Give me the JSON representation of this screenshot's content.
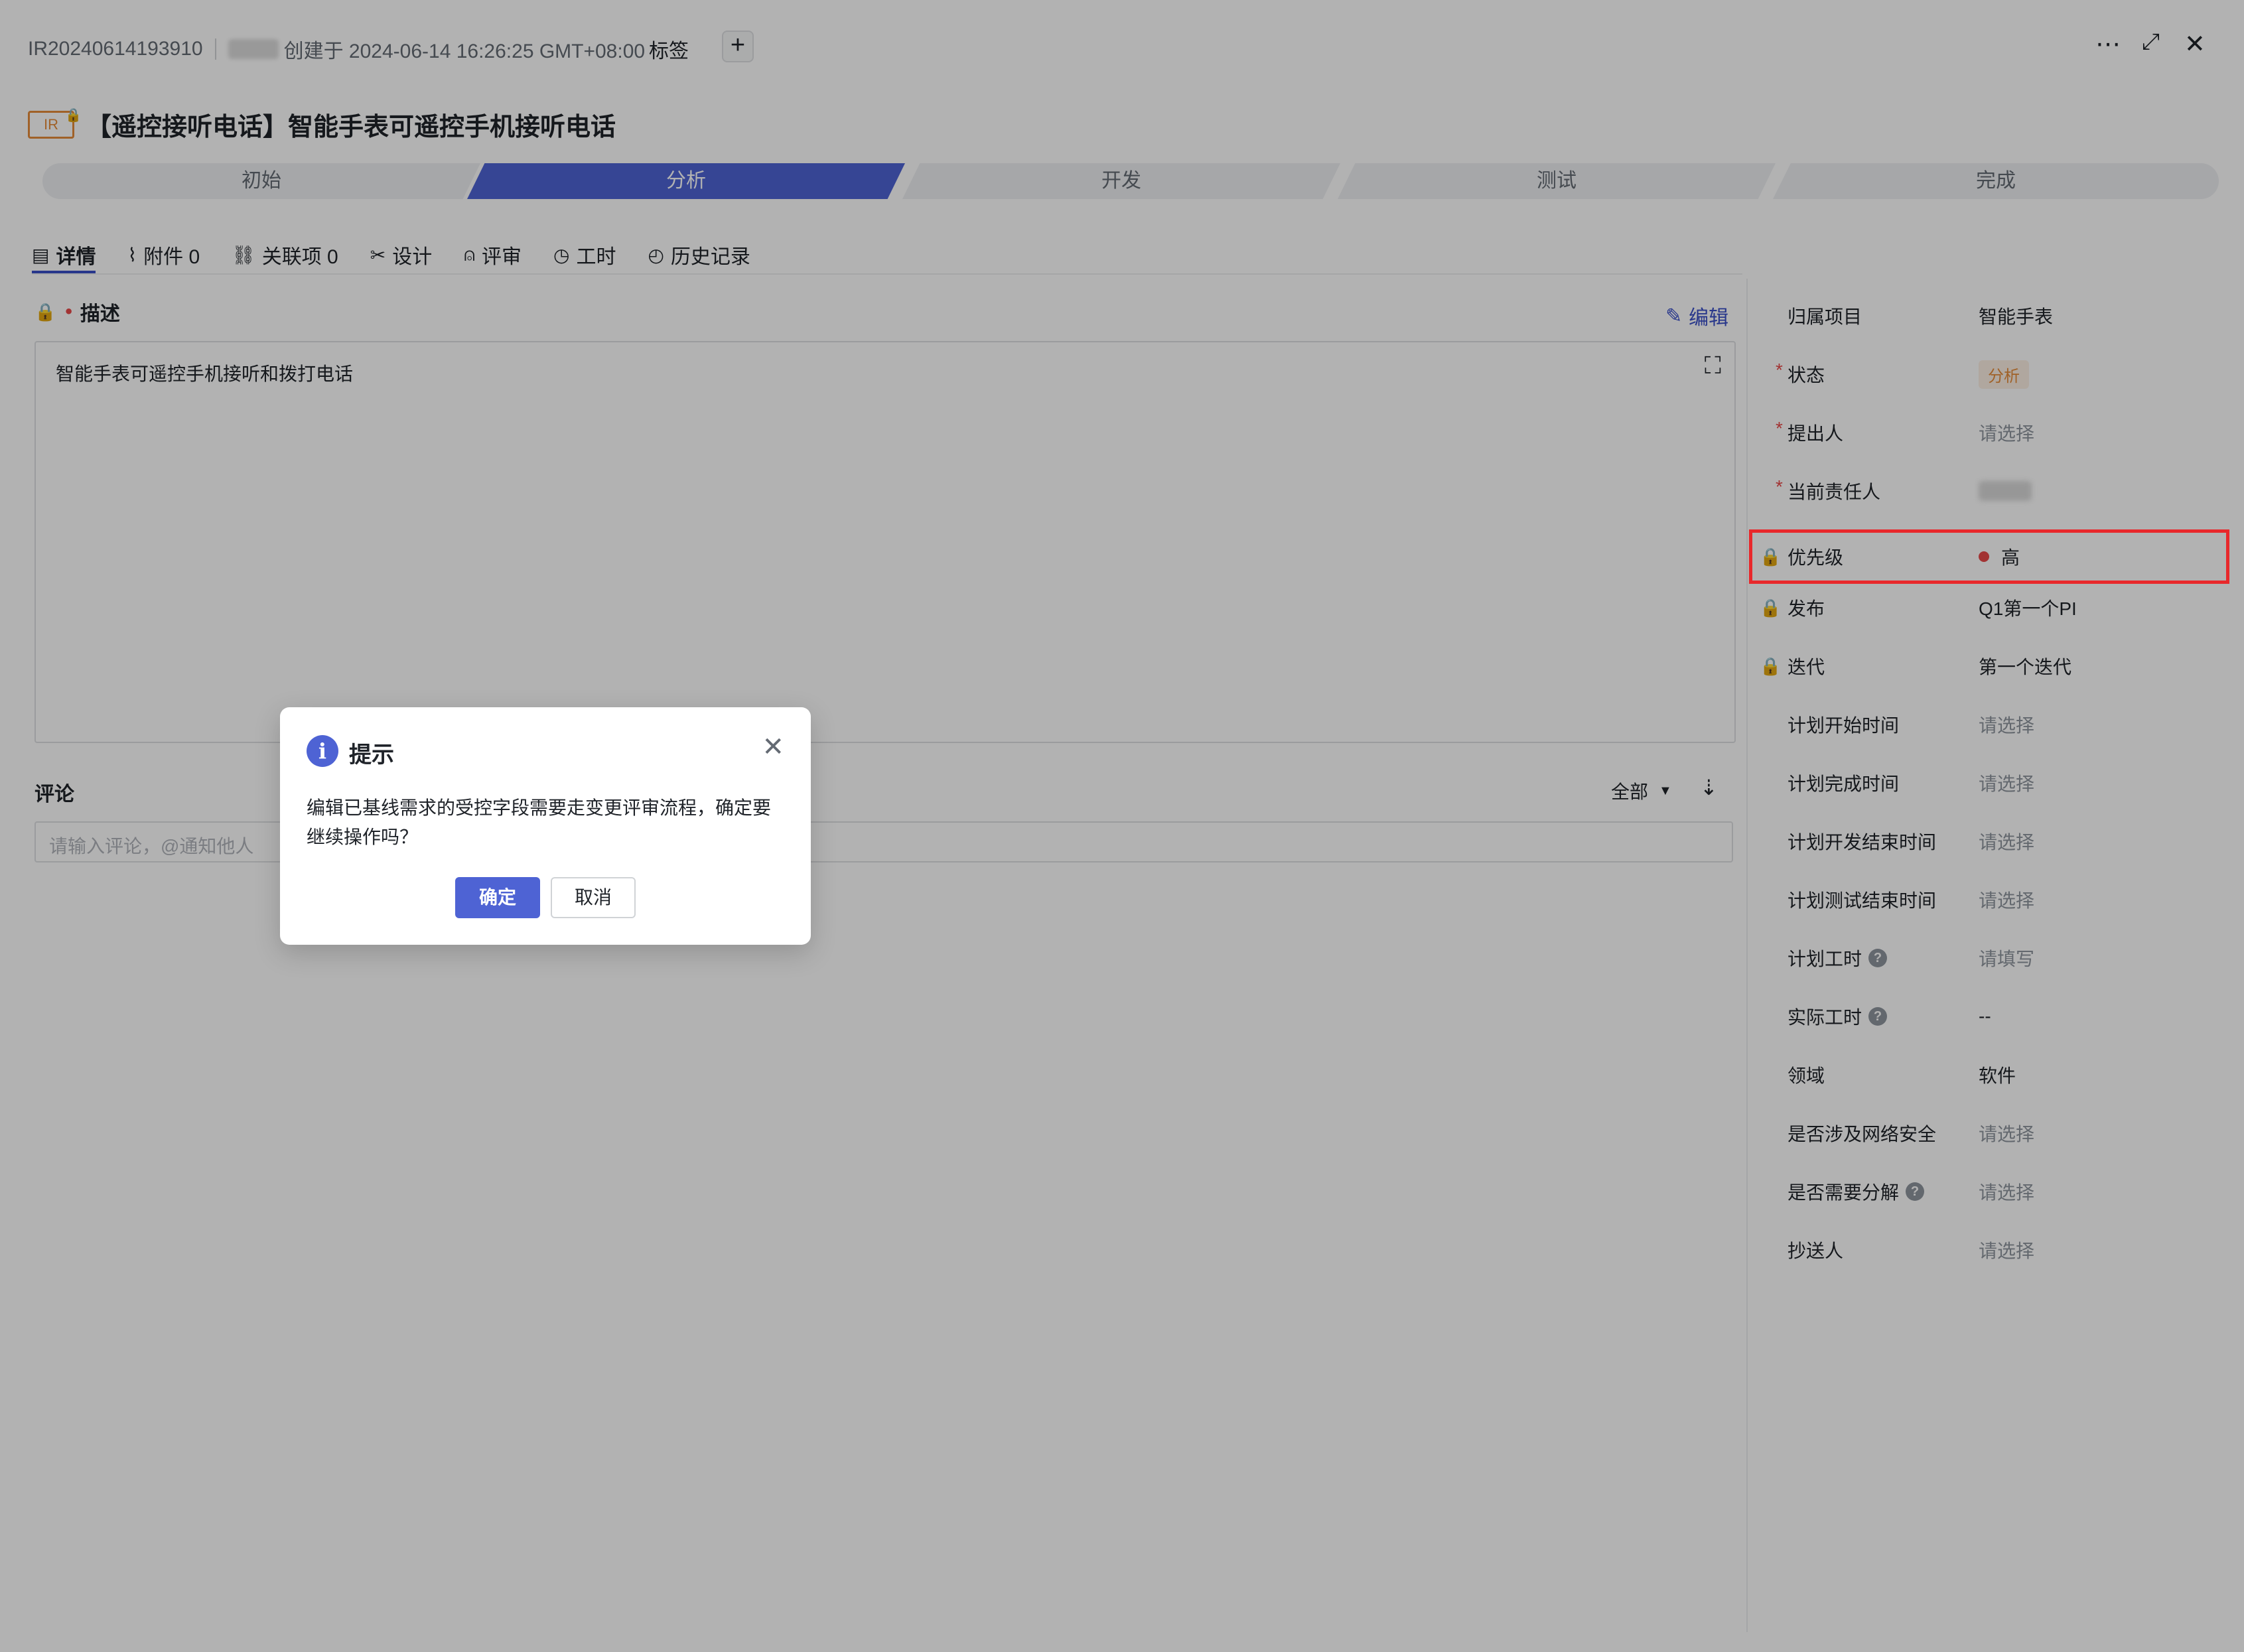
{
  "header": {
    "record_id": "IR20240614193910",
    "created_text": "创建于 2024-06-14 16:26:25 GMT+08:00",
    "tag_label": "标签",
    "add_tag_symbol": "+",
    "more_icon": "more-icon",
    "expand_icon": "expand-icon",
    "close_icon": "close-icon"
  },
  "title": {
    "type_badge": "IR",
    "text": "【遥控接听电话】智能手表可遥控手机接听电话"
  },
  "stages": [
    {
      "label": "初始",
      "active": false
    },
    {
      "label": "分析",
      "active": true
    },
    {
      "label": "开发",
      "active": false
    },
    {
      "label": "测试",
      "active": false
    },
    {
      "label": "完成",
      "active": false
    }
  ],
  "tabs": [
    {
      "label": "详情",
      "icon": "document-icon"
    },
    {
      "label": "附件 0",
      "icon": "paperclip-icon"
    },
    {
      "label": "关联项 0",
      "icon": "link-icon"
    },
    {
      "label": "设计",
      "icon": "design-icon"
    },
    {
      "label": "评审",
      "icon": "stamp-icon"
    },
    {
      "label": "工时",
      "icon": "clock-icon"
    },
    {
      "label": "历史记录",
      "icon": "history-icon"
    }
  ],
  "description": {
    "label": "描述",
    "edit_label": "编辑",
    "content": "智能手表可遥控手机接听和拨打电话"
  },
  "comments": {
    "label": "评论",
    "filter_label": "全部",
    "placeholder": "请输入评论，@通知他人"
  },
  "properties": [
    {
      "label": "归属项目",
      "value": "智能手表"
    },
    {
      "label": "状态",
      "value": "分析"
    },
    {
      "label": "提出人",
      "value": "请选择"
    },
    {
      "label": "当前责任人",
      "value": ""
    },
    {
      "label": "优先级",
      "value": "高"
    },
    {
      "label": "发布",
      "value": "Q1第一个PI"
    },
    {
      "label": "迭代",
      "value": "第一个迭代"
    },
    {
      "label": "计划开始时间",
      "value": "请选择"
    },
    {
      "label": "计划完成时间",
      "value": "请选择"
    },
    {
      "label": "计划开发结束时间",
      "value": "请选择"
    },
    {
      "label": "计划测试结束时间",
      "value": "请选择"
    },
    {
      "label": "计划工时",
      "value": "请填写"
    },
    {
      "label": "实际工时",
      "value": "--"
    },
    {
      "label": "领域",
      "value": "软件"
    },
    {
      "label": "是否涉及网络安全",
      "value": "请选择"
    },
    {
      "label": "是否需要分解",
      "value": "请选择"
    },
    {
      "label": "抄送人",
      "value": "请选择"
    }
  ],
  "dialog": {
    "title": "提示",
    "message": "编辑已基线需求的受控字段需要走变更评审流程，确定要继续操作吗？",
    "confirm_label": "确定",
    "cancel_label": "取消"
  },
  "colors": {
    "accent": "#4e63d4",
    "status_orange": "#e58c3a",
    "required_red": "#e84a4a",
    "highlight_red": "#e8282b"
  }
}
